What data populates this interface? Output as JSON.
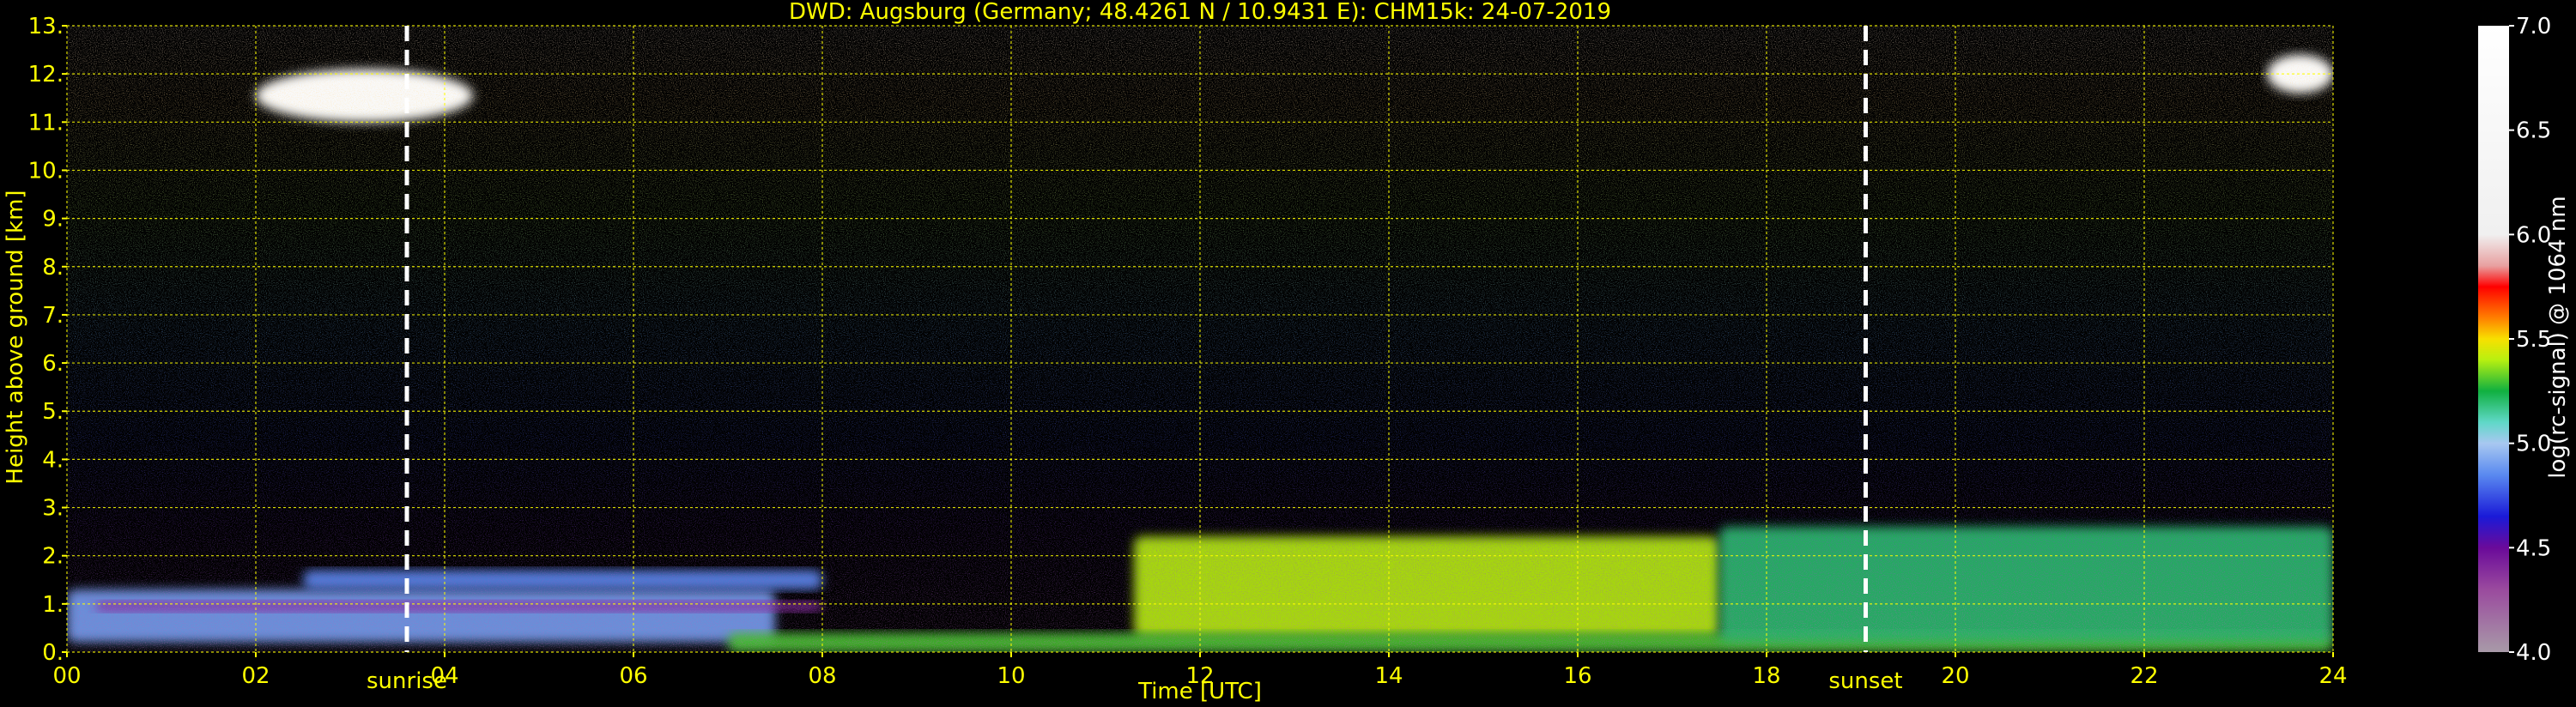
{
  "chart_data": {
    "type": "heatmap",
    "title": "DWD: Augsburg (Germany; 48.4261 N / 10.9431 E):    CHM15k: 24-07-2019",
    "xlabel": "Time [UTC]",
    "ylabel": "Height above ground [km]",
    "xlim": [
      0,
      24
    ],
    "ylim": [
      0,
      13
    ],
    "xticks": [
      0,
      2,
      4,
      6,
      8,
      10,
      12,
      14,
      16,
      18,
      20,
      22,
      24
    ],
    "xtick_labels": [
      "00",
      "02",
      "04",
      "06",
      "08",
      "10",
      "12",
      "14",
      "16",
      "18",
      "20",
      "22",
      "24"
    ],
    "yticks": [
      0,
      1,
      2,
      3,
      4,
      5,
      6,
      7,
      8,
      9,
      10,
      11,
      12,
      13
    ],
    "ytick_labels": [
      "0.",
      "1.",
      "2.",
      "3.",
      "4.",
      "5.",
      "6.",
      "7.",
      "8.",
      "9.",
      "10.",
      "11.",
      "12.",
      "13."
    ],
    "grid": true,
    "markers": [
      {
        "label": "sunrise",
        "x": 3.6
      },
      {
        "label": "sunset",
        "x": 19.05
      }
    ],
    "colorbar": {
      "label": "log(rc-signal) @ 1064 nm",
      "range": [
        4.0,
        7.0
      ],
      "ticks": [
        4.0,
        4.5,
        5.0,
        5.5,
        6.0,
        6.5,
        7.0
      ],
      "tick_labels": [
        "4.0",
        "4.5",
        "5.0",
        "5.5",
        "6.0",
        "6.5",
        "7.0"
      ],
      "stops": [
        {
          "v": 4.0,
          "color": "#a89aa8"
        },
        {
          "v": 4.3,
          "color": "#9a4a9e"
        },
        {
          "v": 4.5,
          "color": "#6a0a9a"
        },
        {
          "v": 4.65,
          "color": "#1a1ad8"
        },
        {
          "v": 4.85,
          "color": "#5a8af0"
        },
        {
          "v": 5.0,
          "color": "#a8c8f0"
        },
        {
          "v": 5.1,
          "color": "#60d8c8"
        },
        {
          "v": 5.25,
          "color": "#10b040"
        },
        {
          "v": 5.4,
          "color": "#b8f010"
        },
        {
          "v": 5.5,
          "color": "#f8e000"
        },
        {
          "v": 5.6,
          "color": "#ff8000"
        },
        {
          "v": 5.75,
          "color": "#ff0000"
        },
        {
          "v": 5.85,
          "color": "#e8a0a0"
        },
        {
          "v": 6.0,
          "color": "#f0f0f0"
        },
        {
          "v": 7.0,
          "color": "#ffffff"
        }
      ]
    },
    "layers": [
      {
        "feature": "cirrus cloud",
        "t_start": 2.0,
        "t_end": 4.3,
        "h_bottom": 11.0,
        "h_top": 12.1,
        "value": 6.6
      },
      {
        "feature": "cirrus cloud",
        "t_start": 23.3,
        "t_end": 24.0,
        "h_bottom": 11.6,
        "h_top": 12.4,
        "value": 6.6
      },
      {
        "feature": "residual layer",
        "t_start": 0.0,
        "t_end": 7.5,
        "h_bottom": 0.2,
        "h_top": 1.3,
        "value": 4.9
      },
      {
        "feature": "nocturnal aerosol band",
        "t_start": 0.3,
        "t_end": 8.0,
        "h_bottom": 0.85,
        "h_top": 1.05,
        "value": 4.4
      },
      {
        "feature": "aerosol layer",
        "t_start": 2.5,
        "t_end": 8.0,
        "h_bottom": 1.3,
        "h_top": 1.7,
        "value": 4.85
      },
      {
        "feature": "convective boundary layer",
        "t_start": 11.3,
        "t_end": 17.5,
        "h_bottom": 0.3,
        "h_top": 2.4,
        "value": 5.4
      },
      {
        "feature": "surface layer",
        "t_start": 7.0,
        "t_end": 24.0,
        "h_bottom": 0.0,
        "h_top": 0.4,
        "value": 5.3
      },
      {
        "feature": "evening boundary layer",
        "t_start": 17.5,
        "t_end": 24.0,
        "h_bottom": 0.2,
        "h_top": 2.6,
        "value": 5.2
      }
    ]
  }
}
